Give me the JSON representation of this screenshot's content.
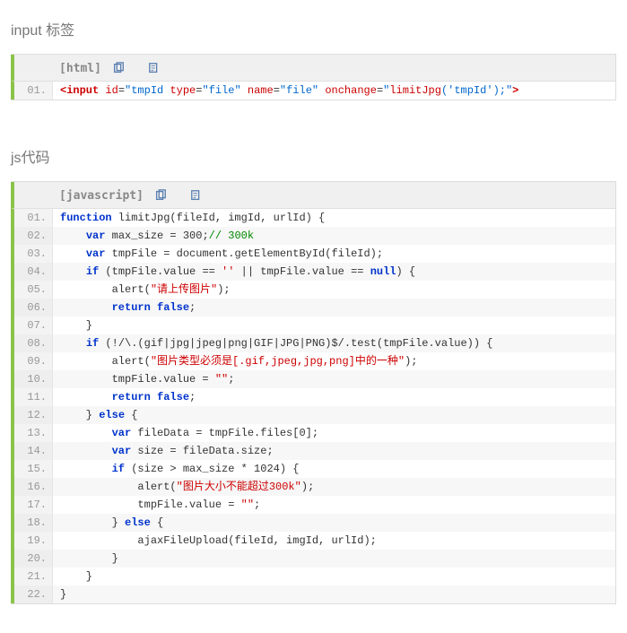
{
  "section1": {
    "title": "input 标签",
    "lang": "[html]",
    "icons": [
      "copy",
      "view"
    ],
    "lines": [
      {
        "n": "01.",
        "html": "<span class='tag'>&lt;input</span> <span class='attr'>id</span>=<span class='val'>\"tmpId</span> <span class='attr'>type</span>=<span class='val'>\"file\"</span> <span class='attr'>name</span>=<span class='val'>\"file\"</span> <span class='attr'>onchange</span>=<span class='val'>\"</span><span class='func'>limitJpg</span><span class='val'>('tmpId');\"</span><span class='tag'>&gt;</span>"
      }
    ]
  },
  "section2": {
    "title": "js代码",
    "lang": "[javascript]",
    "icons": [
      "copy",
      "view"
    ],
    "lines": [
      {
        "n": "01.",
        "html": "<span class='kw'>function</span> limitJpg(fileId, imgId, urlId) {"
      },
      {
        "n": "02.",
        "html": "    <span class='kw'>var</span> max_size = 300;<span class='cmt'>// 300k</span>"
      },
      {
        "n": "03.",
        "html": "    <span class='kw'>var</span> tmpFile = document.getElementById(fileId);"
      },
      {
        "n": "04.",
        "html": "    <span class='kw'>if</span> (tmpFile.value == <span class='str'>''</span> || tmpFile.value == <span class='kw'>null</span>) {"
      },
      {
        "n": "05.",
        "html": "        alert(<span class='str'>\"请上传图片\"</span>);"
      },
      {
        "n": "06.",
        "html": "        <span class='kw'>return</span> <span class='kw'>false</span>;"
      },
      {
        "n": "07.",
        "html": "    }"
      },
      {
        "n": "08.",
        "html": "    <span class='kw'>if</span> (!/\\.(gif|jpg|jpeg|png|GIF|JPG|PNG)$/.test(tmpFile.value)) {"
      },
      {
        "n": "09.",
        "html": "        alert(<span class='str'>\"图片类型必须是[.gif,jpeg,jpg,png]中的一种\"</span>);"
      },
      {
        "n": "10.",
        "html": "        tmpFile.value = <span class='str'>\"\"</span>;"
      },
      {
        "n": "11.",
        "html": "        <span class='kw'>return</span> <span class='kw'>false</span>;"
      },
      {
        "n": "12.",
        "html": "    } <span class='kw'>else</span> {"
      },
      {
        "n": "13.",
        "html": "        <span class='kw'>var</span> fileData = tmpFile.files[0];"
      },
      {
        "n": "14.",
        "html": "        <span class='kw'>var</span> size = fileData.size;"
      },
      {
        "n": "15.",
        "html": "        <span class='kw'>if</span> (size &gt; max_size * 1024) {"
      },
      {
        "n": "16.",
        "html": "            alert(<span class='str'>\"图片大小不能超过300k\"</span>);"
      },
      {
        "n": "17.",
        "html": "            tmpFile.value = <span class='str'>\"\"</span>;"
      },
      {
        "n": "18.",
        "html": "        } <span class='kw'>else</span> {"
      },
      {
        "n": "19.",
        "html": "            ajaxFileUpload(fileId, imgId, urlId);"
      },
      {
        "n": "20.",
        "html": "        }"
      },
      {
        "n": "21.",
        "html": "    }"
      },
      {
        "n": "22.",
        "html": "}"
      }
    ]
  }
}
